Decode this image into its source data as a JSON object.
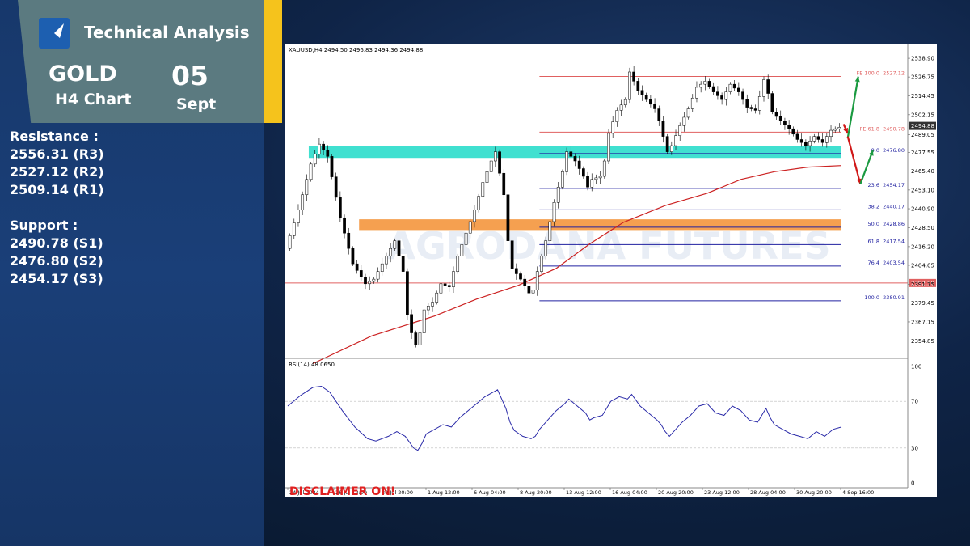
{
  "header": {
    "title": "Technical Analysis",
    "instrument": "GOLD",
    "timeframe": "H4 Chart",
    "day": "05",
    "month": "Sept"
  },
  "levels": {
    "resistance_heading": "Resistance :",
    "resistance": [
      "2556.31 (R3)",
      "2527.12 (R2)",
      "2509.14 (R1)"
    ],
    "support_heading": "Support :",
    "support": [
      "2490.78 (S1)",
      "2476.80 (S2)",
      "2454.17 (S3)"
    ]
  },
  "colors": {
    "accent_yellow": "#f5c31c",
    "header_bg": "#5b7a80",
    "resistance_line": "#e06060",
    "fib_line": "#2020a0",
    "support_zone": "#40e0d0",
    "demand_zone": "#f5a050",
    "ma": "#cc2222",
    "rsi": "#2a2aa8",
    "arrow_up": "#1a9a40",
    "arrow_down": "#d01818"
  },
  "chart_data": {
    "type": "candlestick",
    "symbol_info": "XAUUSD,H4  2494.50 2496.83 2494.36 2494.88",
    "watermark": "AGRODANA FUTURES",
    "disclaimer": "DISCLAIMER ON!",
    "ylim": [
      2345,
      2540
    ],
    "price_ticks": [
      "2538.90",
      "2526.75",
      "2514.45",
      "2502.15",
      "2489.05",
      "2477.55",
      "2465.40",
      "2453.10",
      "2440.90",
      "2428.50",
      "2416.20",
      "2404.05",
      "2391.75",
      "2379.45",
      "2367.15",
      "2354.85"
    ],
    "current_price": "2494.88",
    "x_labels": [
      "24 Jul 2024",
      "26 Jul 12:00",
      "29 Jul 20:00",
      "1 Aug 12:00",
      "6 Aug 04:00",
      "8 Aug 20:00",
      "13 Aug 12:00",
      "16 Aug 04:00",
      "20 Aug 20:00",
      "23 Aug 12:00",
      "28 Aug 04:00",
      "30 Aug 20:00",
      "4 Sep 16:00"
    ],
    "price_path": [
      [
        0,
        2415
      ],
      [
        3,
        2440
      ],
      [
        6,
        2470
      ],
      [
        8,
        2483
      ],
      [
        10,
        2475
      ],
      [
        13,
        2435
      ],
      [
        16,
        2405
      ],
      [
        19,
        2392
      ],
      [
        21,
        2395
      ],
      [
        24,
        2410
      ],
      [
        26,
        2420
      ],
      [
        28,
        2400
      ],
      [
        29,
        2372
      ],
      [
        30,
        2360
      ],
      [
        31,
        2352
      ],
      [
        32,
        2360
      ],
      [
        33,
        2375
      ],
      [
        35,
        2380
      ],
      [
        37,
        2392
      ],
      [
        39,
        2390
      ],
      [
        41,
        2410
      ],
      [
        43,
        2425
      ],
      [
        45,
        2440
      ],
      [
        47,
        2458
      ],
      [
        49,
        2472
      ],
      [
        50,
        2478
      ],
      [
        52,
        2450
      ],
      [
        53,
        2420
      ],
      [
        54,
        2402
      ],
      [
        56,
        2395
      ],
      [
        58,
        2386
      ],
      [
        59,
        2388
      ],
      [
        60,
        2400
      ],
      [
        62,
        2420
      ],
      [
        64,
        2445
      ],
      [
        66,
        2465
      ],
      [
        67,
        2478
      ],
      [
        69,
        2472
      ],
      [
        71,
        2462
      ],
      [
        72,
        2455
      ],
      [
        73,
        2460
      ],
      [
        75,
        2462
      ],
      [
        76,
        2472
      ],
      [
        77,
        2490
      ],
      [
        79,
        2505
      ],
      [
        81,
        2512
      ],
      [
        82,
        2530
      ],
      [
        84,
        2518
      ],
      [
        86,
        2512
      ],
      [
        88,
        2506
      ],
      [
        89,
        2498
      ],
      [
        90,
        2488
      ],
      [
        91,
        2478
      ],
      [
        92,
        2482
      ],
      [
        94,
        2495
      ],
      [
        96,
        2506
      ],
      [
        98,
        2520
      ],
      [
        100,
        2524
      ],
      [
        102,
        2517
      ],
      [
        104,
        2512
      ],
      [
        106,
        2522
      ],
      [
        108,
        2517
      ],
      [
        110,
        2507
      ],
      [
        112,
        2505
      ],
      [
        113,
        2514
      ],
      [
        114,
        2525
      ],
      [
        115,
        2516
      ],
      [
        116,
        2504
      ],
      [
        118,
        2498
      ],
      [
        120,
        2493
      ],
      [
        122,
        2486
      ],
      [
        124,
        2482
      ],
      [
        126,
        2488
      ],
      [
        128,
        2484
      ],
      [
        130,
        2492
      ],
      [
        132,
        2494
      ]
    ],
    "ma200": [
      [
        6,
        2340
      ],
      [
        20,
        2358
      ],
      [
        35,
        2371
      ],
      [
        45,
        2382
      ],
      [
        55,
        2391
      ],
      [
        64,
        2402
      ],
      [
        72,
        2418
      ],
      [
        80,
        2432
      ],
      [
        90,
        2443
      ],
      [
        100,
        2451
      ],
      [
        108,
        2460
      ],
      [
        116,
        2465
      ],
      [
        124,
        2468
      ],
      [
        132,
        2469
      ]
    ],
    "resistance_lines": [
      {
        "price": 2392.5,
        "label": "2392.50"
      }
    ],
    "fibonacci": [
      {
        "level": "FE 100.0",
        "price": "2527.12",
        "value": 2527.12,
        "color": "#e06060"
      },
      {
        "level": "FE 61.8",
        "price": "2490.78",
        "value": 2490.78,
        "color": "#e06060"
      },
      {
        "level": "0.0",
        "price": "2476.80",
        "value": 2476.8,
        "color": "#2020a0"
      },
      {
        "level": "23.6",
        "price": "2454.17",
        "value": 2454.17,
        "color": "#2020a0"
      },
      {
        "level": "38.2",
        "price": "2440.17",
        "value": 2440.17,
        "color": "#2020a0"
      },
      {
        "level": "50.0",
        "price": "2428.86",
        "value": 2428.86,
        "color": "#2020a0"
      },
      {
        "level": "61.8",
        "price": "2417.54",
        "value": 2417.54,
        "color": "#2020a0"
      },
      {
        "level": "76.4",
        "price": "2403.54",
        "value": 2403.54,
        "color": "#2020a0"
      },
      {
        "level": "100.0",
        "price": "2380.91",
        "value": 2380.91,
        "color": "#2020a0"
      }
    ],
    "zones": [
      {
        "name": "support-zone",
        "from": 2474,
        "to": 2482,
        "x_start": 5,
        "color": "#40e0d0"
      },
      {
        "name": "demand-zone",
        "from": 2427,
        "to": 2434,
        "x_start": 17,
        "color": "#f5a050"
      }
    ],
    "rsi": {
      "label": "RSI(14) 48.0650",
      "ticks": [
        "100",
        "70",
        "30",
        "0"
      ],
      "levels": [
        70,
        30
      ],
      "values": [
        [
          0,
          66
        ],
        [
          3,
          75
        ],
        [
          6,
          82
        ],
        [
          8,
          83
        ],
        [
          10,
          78
        ],
        [
          13,
          62
        ],
        [
          16,
          48
        ],
        [
          19,
          38
        ],
        [
          21,
          36
        ],
        [
          24,
          40
        ],
        [
          26,
          44
        ],
        [
          28,
          40
        ],
        [
          29,
          35
        ],
        [
          30,
          30
        ],
        [
          31,
          28
        ],
        [
          32,
          34
        ],
        [
          33,
          42
        ],
        [
          35,
          46
        ],
        [
          37,
          50
        ],
        [
          39,
          48
        ],
        [
          41,
          56
        ],
        [
          43,
          62
        ],
        [
          45,
          68
        ],
        [
          47,
          74
        ],
        [
          49,
          78
        ],
        [
          50,
          80
        ],
        [
          52,
          64
        ],
        [
          53,
          52
        ],
        [
          54,
          45
        ],
        [
          56,
          40
        ],
        [
          58,
          38
        ],
        [
          59,
          40
        ],
        [
          60,
          46
        ],
        [
          62,
          54
        ],
        [
          64,
          62
        ],
        [
          66,
          68
        ],
        [
          67,
          72
        ],
        [
          69,
          66
        ],
        [
          71,
          60
        ],
        [
          72,
          54
        ],
        [
          73,
          56
        ],
        [
          75,
          58
        ],
        [
          76,
          64
        ],
        [
          77,
          70
        ],
        [
          79,
          74
        ],
        [
          81,
          72
        ],
        [
          82,
          76
        ],
        [
          84,
          66
        ],
        [
          86,
          60
        ],
        [
          88,
          54
        ],
        [
          89,
          50
        ],
        [
          90,
          44
        ],
        [
          91,
          40
        ],
        [
          92,
          44
        ],
        [
          94,
          52
        ],
        [
          96,
          58
        ],
        [
          98,
          66
        ],
        [
          100,
          68
        ],
        [
          102,
          60
        ],
        [
          104,
          58
        ],
        [
          106,
          66
        ],
        [
          108,
          62
        ],
        [
          110,
          54
        ],
        [
          112,
          52
        ],
        [
          113,
          58
        ],
        [
          114,
          64
        ],
        [
          115,
          56
        ],
        [
          116,
          50
        ],
        [
          118,
          46
        ],
        [
          120,
          42
        ],
        [
          122,
          40
        ],
        [
          124,
          38
        ],
        [
          126,
          44
        ],
        [
          128,
          40
        ],
        [
          130,
          46
        ],
        [
          132,
          48
        ]
      ]
    }
  }
}
